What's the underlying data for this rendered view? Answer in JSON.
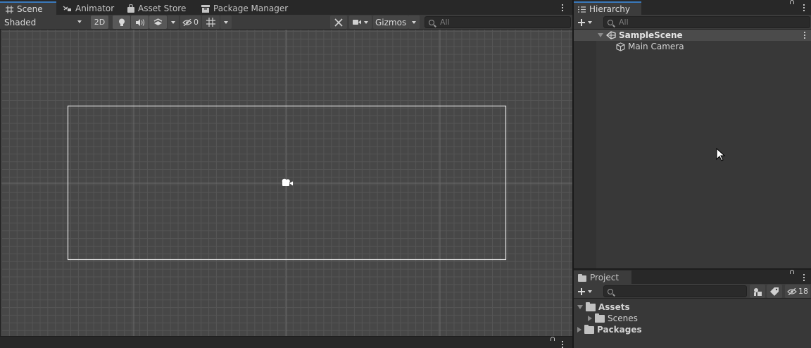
{
  "scene_panel": {
    "tabs": [
      {
        "label": "Scene",
        "icon": "grid-icon",
        "active": true
      },
      {
        "label": "Animator",
        "icon": "animator-icon",
        "active": false
      },
      {
        "label": "Asset Store",
        "icon": "shopping-bag-icon",
        "active": false
      },
      {
        "label": "Package Manager",
        "icon": "package-icon",
        "active": false
      }
    ],
    "toolbar": {
      "draw_mode": "Shaded",
      "mode_2d": "2D",
      "hidden_count": "0",
      "gizmos_label": "Gizmos",
      "search_placeholder": "All"
    }
  },
  "hierarchy": {
    "tab_label": "Hierarchy",
    "search_placeholder": "All",
    "scene_name": "SampleScene",
    "objects": [
      "Main Camera"
    ]
  },
  "project": {
    "tab_label": "Project",
    "search_placeholder": "",
    "hidden_count": "18",
    "tree": [
      {
        "label": "Assets",
        "bold": true,
        "expanded": true
      },
      {
        "label": "Scenes",
        "bold": false,
        "expanded": false
      },
      {
        "label": "Packages",
        "bold": true,
        "expanded": false
      }
    ]
  },
  "colors": {
    "accent": "#3a79bb",
    "panel_bg": "#383838",
    "scene_bg": "#474747"
  }
}
